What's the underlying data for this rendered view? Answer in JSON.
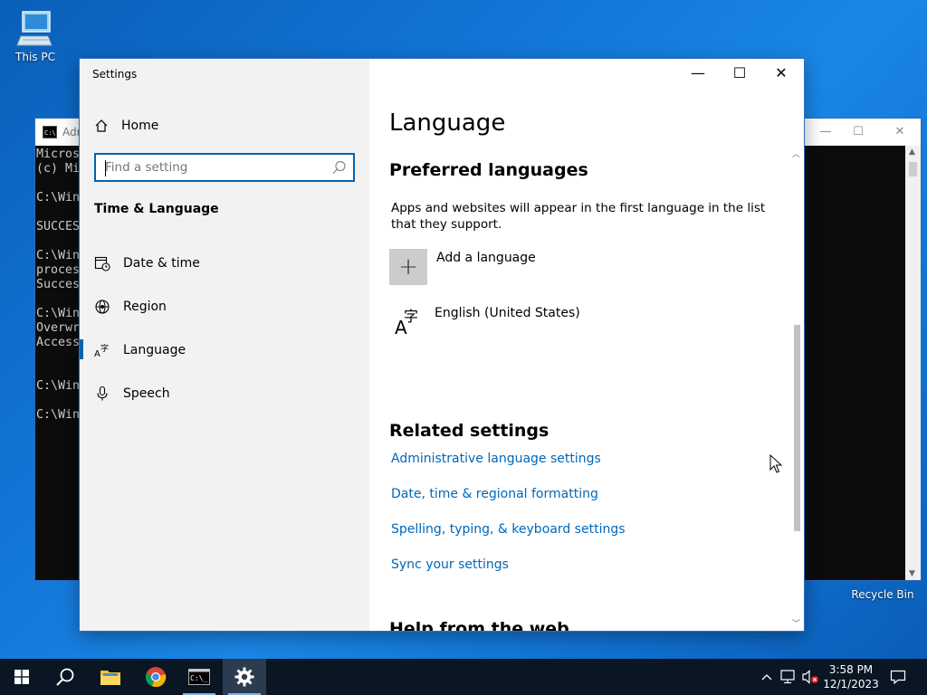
{
  "desktop": {
    "this_pc_label": "This PC",
    "recycle_bin_label": "Recycle Bin"
  },
  "console": {
    "title": "Adr",
    "lines": [
      "Micros",
      "(c) Mi",
      "",
      "C:\\Win",
      "",
      "SUCCES",
      "",
      "C:\\Win",
      "proces",
      "Succes",
      "",
      "C:\\Win",
      "Overwr",
      "Access",
      "",
      "",
      "C:\\Win",
      "",
      "C:\\Win"
    ]
  },
  "settings": {
    "title": "Settings",
    "nav": {
      "home": "Home",
      "search_placeholder": "Find a setting",
      "section": "Time & Language",
      "items": [
        {
          "label": "Date & time",
          "icon": "calendar-clock-icon"
        },
        {
          "label": "Region",
          "icon": "globe-icon"
        },
        {
          "label": "Language",
          "icon": "language-icon"
        },
        {
          "label": "Speech",
          "icon": "microphone-icon"
        }
      ]
    },
    "main": {
      "page_title": "Language",
      "preferred_heading": "Preferred languages",
      "preferred_desc": "Apps and websites will appear in the first language in the list that they support.",
      "add_language": "Add a language",
      "languages": [
        {
          "label": "English (United States)"
        }
      ],
      "related_heading": "Related settings",
      "related_links": [
        "Administrative language settings",
        "Date, time & regional formatting",
        "Spelling, typing, & keyboard settings",
        "Sync your settings"
      ],
      "help_heading": "Help from the web"
    }
  },
  "taskbar": {
    "time": "3:58 PM",
    "date": "12/1/2023"
  },
  "colors": {
    "accent": "#0063b1",
    "link": "#0067b8"
  }
}
